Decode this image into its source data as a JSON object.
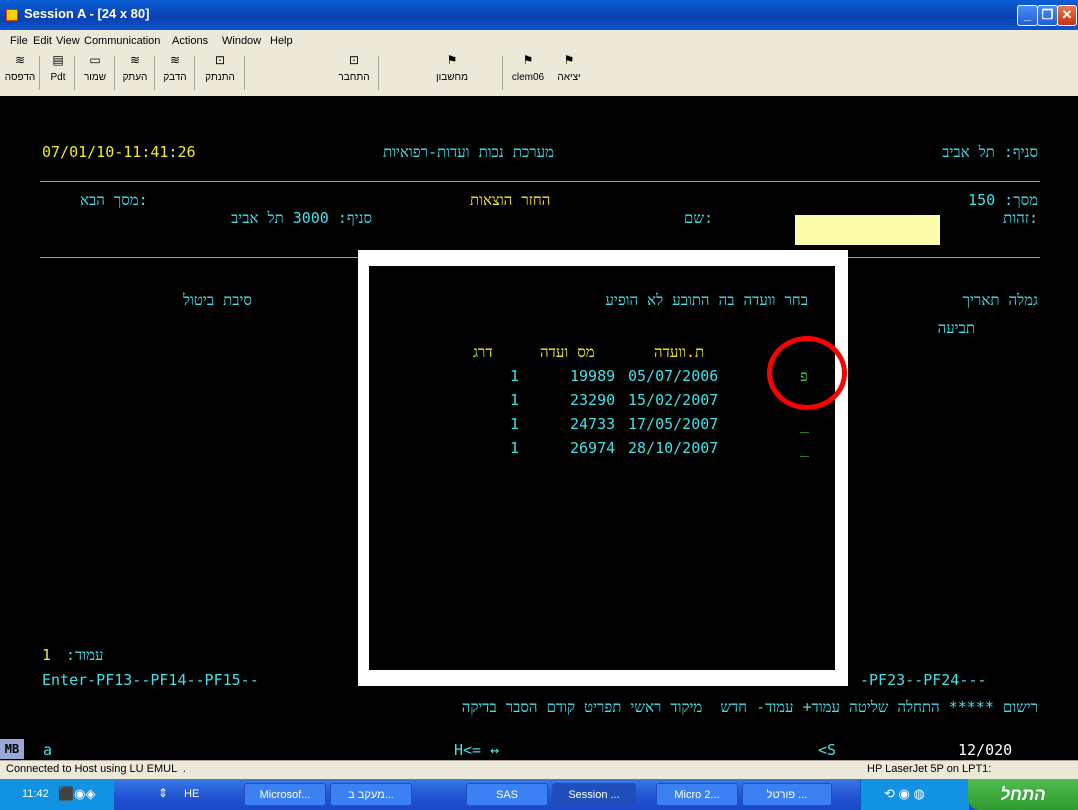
{
  "window": {
    "title": "Session A - [24 x 80]",
    "menu": [
      "File",
      "Edit",
      "View",
      "Communication",
      "Actions",
      "Window",
      "Help"
    ],
    "toolbar": [
      {
        "label": "הדפסה",
        "icon": "print-screen-icon",
        "glyph": "≋"
      },
      {
        "label": "Pdt",
        "icon": "printer-icon",
        "glyph": "▤"
      },
      {
        "label": "שמור",
        "icon": "save-icon",
        "glyph": "▭"
      },
      {
        "label": "העתק",
        "icon": "copy-icon",
        "glyph": "≋"
      },
      {
        "label": "הדבק",
        "icon": "paste-icon",
        "glyph": "≋"
      },
      {
        "label": "התנתק",
        "icon": "disconnect-icon",
        "glyph": "⊡"
      },
      {
        "label": "התחבר",
        "icon": "connect-icon",
        "glyph": "⊡"
      },
      {
        "label": "מחשבון",
        "icon": "calculator-icon",
        "glyph": "⚑"
      },
      {
        "label": "clem06",
        "icon": "macro-icon",
        "glyph": "⚑"
      },
      {
        "label": "יציאה",
        "icon": "exit-icon",
        "glyph": "⚑"
      }
    ]
  },
  "terminal": {
    "datetime": "07/01/10-11:41:26",
    "system_title": "מערכת נכות ועדות-רפואיות",
    "branch_label": "סניף: תל אביב",
    "next_screen_label": ":מסך הבא",
    "screen_title": "החזר הוצאות",
    "screen_number_label": "מסך: 150",
    "branch_code_label": "סניף: 3000 תל אביב",
    "name_label": ":שם",
    "id_label": ":זהות",
    "id_value": "",
    "cancel_reason_label": "סיבת ביטול",
    "benefit_label": "גמלה תאריך",
    "claim_label": "תביעה",
    "page_label": "עמוד:",
    "page_value": "1",
    "pf_left": "Enter-PF13--PF14--PF15--",
    "pf_right": "-PF23--PF24---",
    "bottom_menu": "רישום ***** התחלה שליטה עמוד+ עמוד- חדש  מיקוד ראשי תפריט קודם הסבר בדיקה"
  },
  "popup": {
    "title": "בחר וועדה בה התובע לא הופיע",
    "col_date": "ת.וועדה",
    "col_number": "מס ועדה",
    "col_grade": "דרג",
    "rows": [
      {
        "select": "פ",
        "date": "05/07/2006",
        "number": "19989",
        "grade": "1"
      },
      {
        "select": "_",
        "date": "15/02/2007",
        "number": "23290",
        "grade": "1"
      },
      {
        "select": "_",
        "date": "17/05/2007",
        "number": "24733",
        "grade": "1"
      },
      {
        "select": "_",
        "date": "28/10/2007",
        "number": "26974",
        "grade": "1"
      }
    ],
    "highlight_color": "#ff0000"
  },
  "oia": {
    "mode": "MB",
    "session": "a",
    "direction": "H<= ↔",
    "indicator": "<S",
    "cursor_pos": "12/020"
  },
  "status": {
    "left": "Connected to Host using LU EMUL  .",
    "right": "HP LaserJet 5P on LPT1:"
  },
  "taskbar": {
    "clock": "11:42",
    "lang": "HE",
    "tasks": [
      "Microsof...",
      "מעקב ב...",
      "SAS",
      "Session ...",
      "Micro 2...",
      "פורטל ..."
    ],
    "start_label": "התחל"
  }
}
